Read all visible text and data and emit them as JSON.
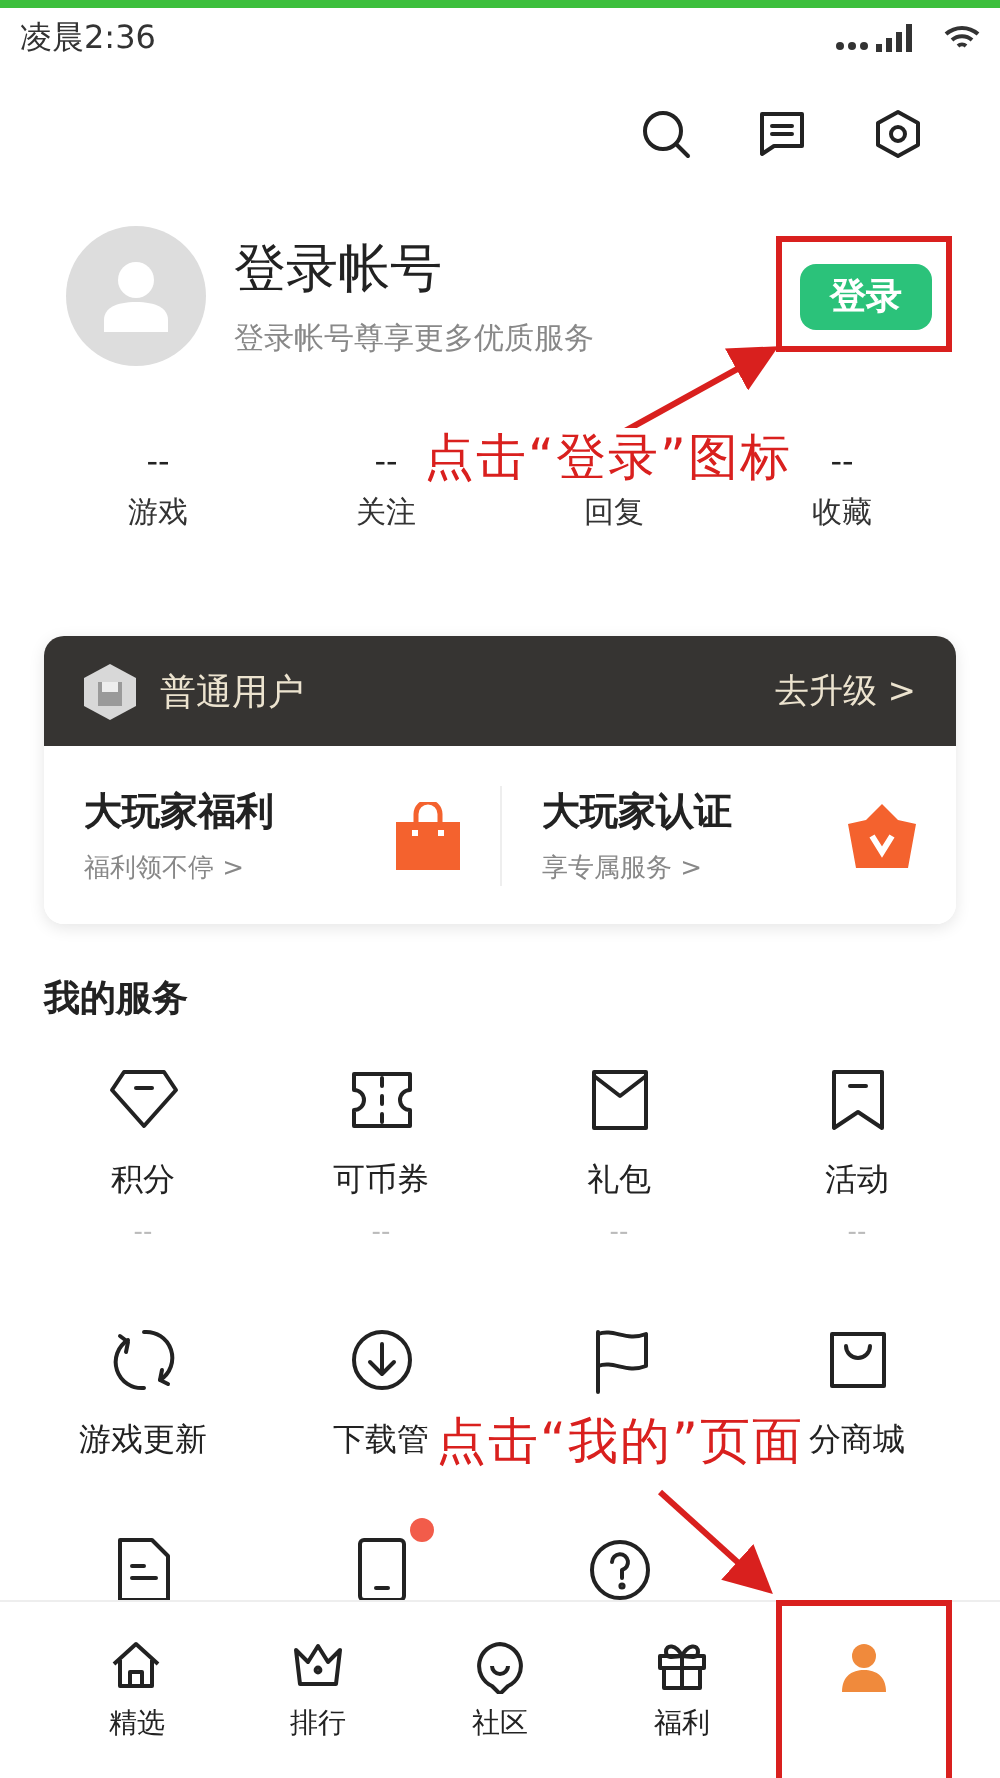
{
  "status_bar": {
    "time": "凌晨2:36"
  },
  "profile": {
    "title": "登录帐号",
    "subtitle": "登录帐号尊享更多优质服务",
    "login_button": "登录"
  },
  "stats": [
    {
      "value": "--",
      "label": "游戏"
    },
    {
      "value": "--",
      "label": "关注"
    },
    {
      "label": "回复"
    },
    {
      "value": "--",
      "label": "收藏"
    }
  ],
  "vip_card": {
    "level": "普通用户",
    "upgrade": "去升级 >",
    "perks": [
      {
        "title": "大玩家福利",
        "subtitle": "福利领不停 >"
      },
      {
        "title": "大玩家认证",
        "subtitle": "享专属服务 >"
      }
    ]
  },
  "services": {
    "title": "我的服务",
    "items": [
      {
        "label": "积分",
        "value": "--"
      },
      {
        "label": "可币券",
        "value": "--"
      },
      {
        "label": "礼包",
        "value": "--"
      },
      {
        "label": "活动",
        "value": "--"
      },
      {
        "label": "游戏更新"
      },
      {
        "label": "下载管"
      },
      {
        "badge": false
      },
      {
        "label": "分商城"
      },
      {
        "badge": false
      },
      {
        "badge": true
      },
      {
        "badge": false
      }
    ]
  },
  "bottom_nav": [
    {
      "label": "精选",
      "selected": false
    },
    {
      "label": "排行",
      "selected": false
    },
    {
      "label": "社区",
      "selected": false
    },
    {
      "label": "福利",
      "selected": false
    },
    {
      "selected": true
    }
  ],
  "annotations": [
    {
      "text": "点击“登录”图标"
    },
    {
      "text": "点击“我的”页面"
    }
  ]
}
